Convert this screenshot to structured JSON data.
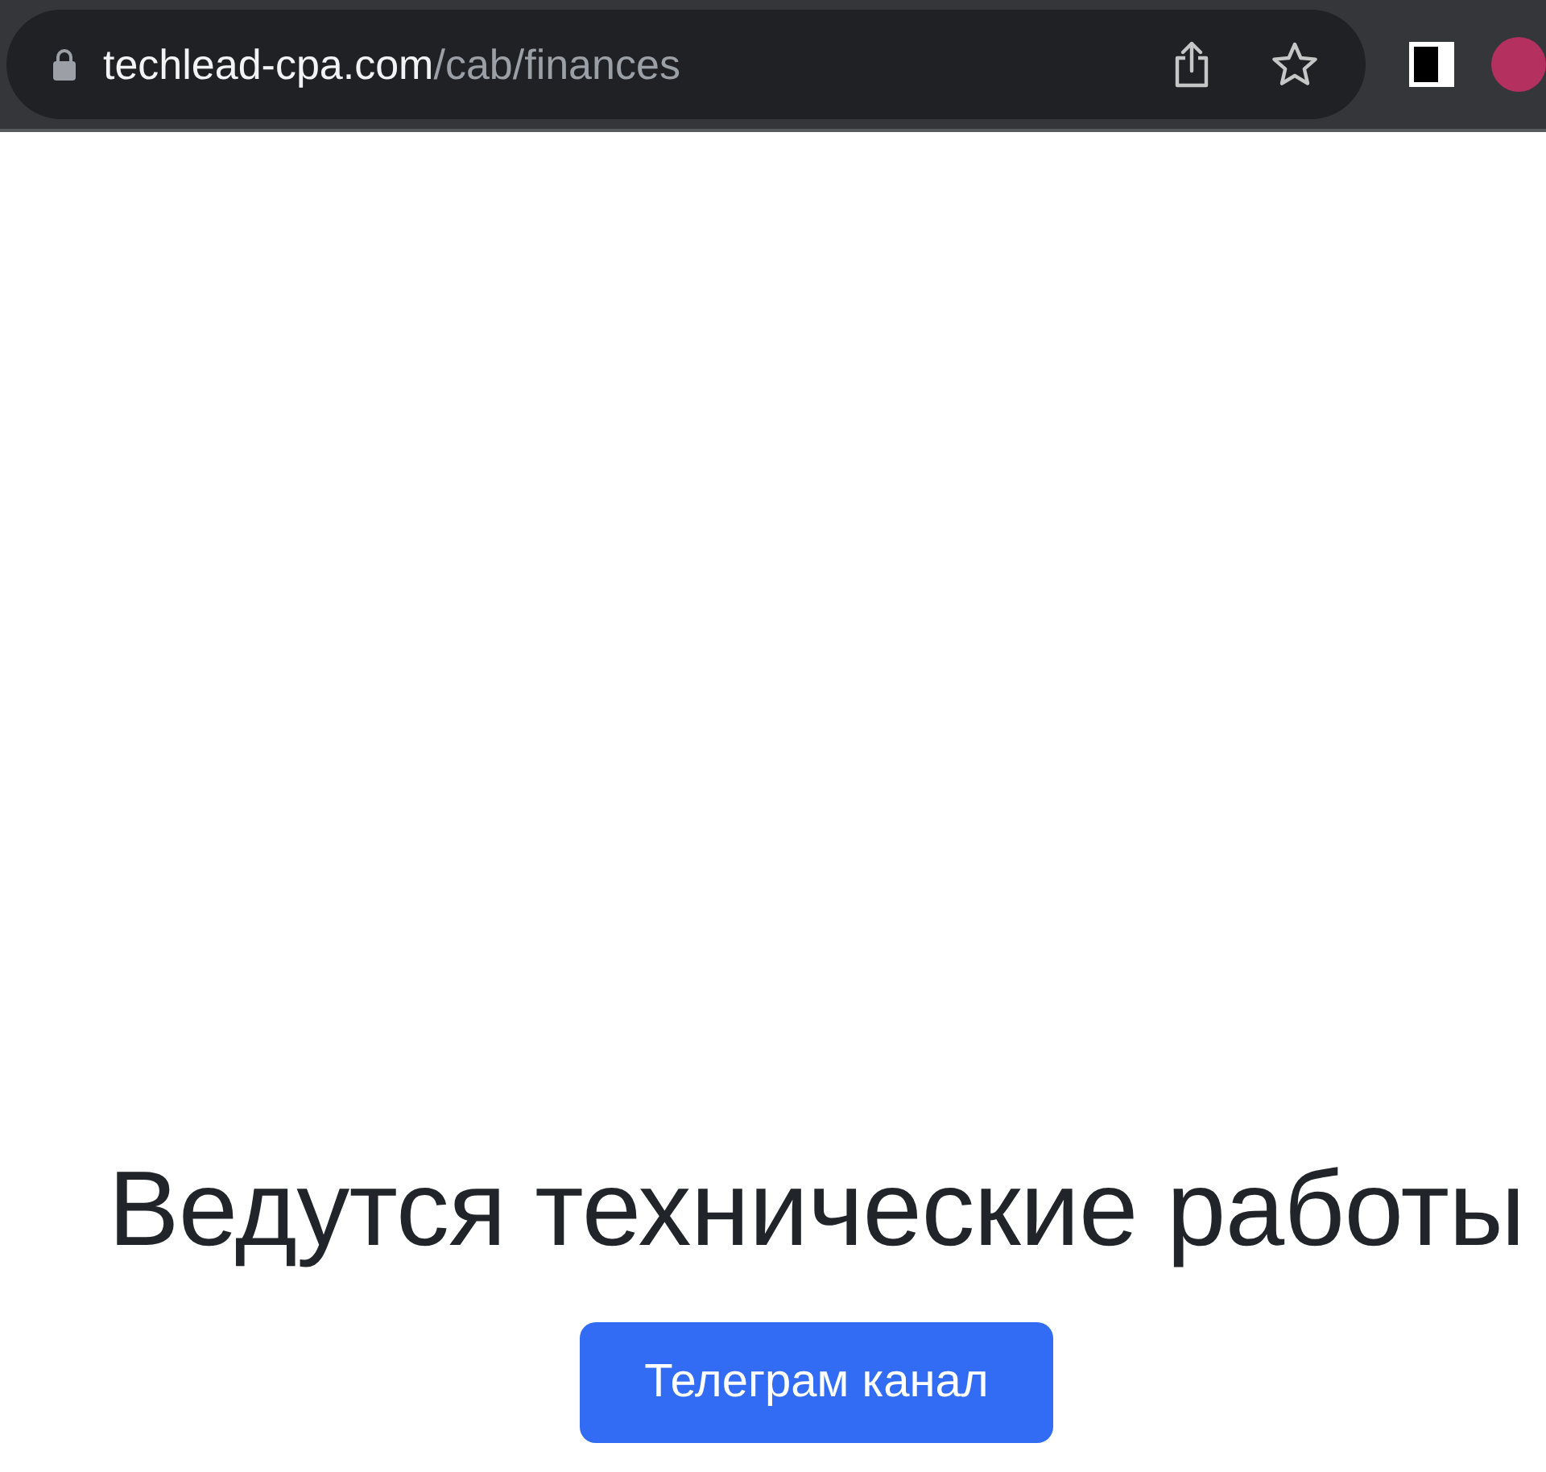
{
  "browser": {
    "url_domain": "techlead-cpa.com",
    "url_path": "/cab/finances"
  },
  "page": {
    "heading": "Ведутся технические работы",
    "button": "Телеграм канал"
  }
}
